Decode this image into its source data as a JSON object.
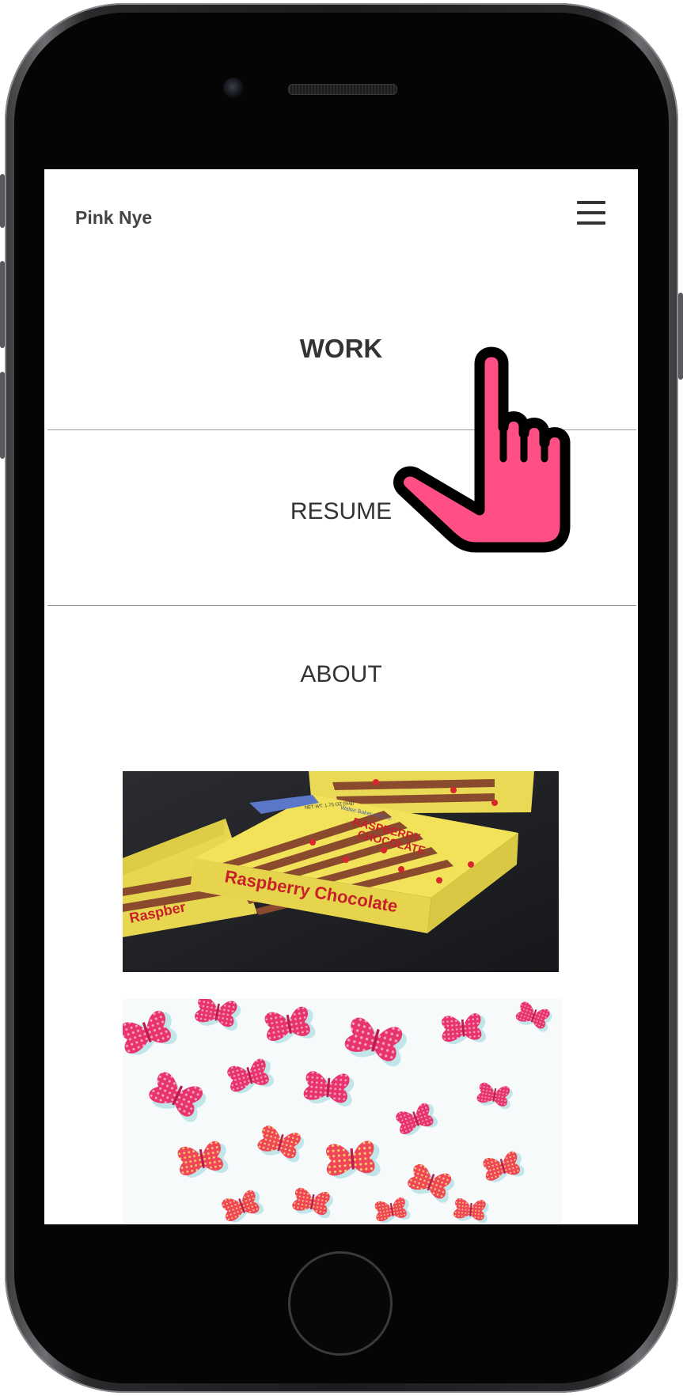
{
  "app": {
    "site_name": "Pink Nye"
  },
  "nav": {
    "items": [
      {
        "label": "WORK",
        "active": true
      },
      {
        "label": "RESUME",
        "active": false
      },
      {
        "label": "ABOUT",
        "active": false
      }
    ]
  },
  "icons": {
    "menu": "hamburger-menu-icon",
    "pointer": "pointing-hand-icon"
  },
  "thumbnails": {
    "chocolate": {
      "box_brand": "Walter Baker and Co.",
      "box_title_1": "RASPBERRY",
      "box_title_2": "CHOCOLATE",
      "side_label": "Raspberry Chocolate",
      "side_label_back": "Raspber",
      "weight": "NET WT. 1.75 OZ (50g)"
    }
  },
  "colors": {
    "hand_pink": "#ff4f85",
    "text_dark": "#333333",
    "divider": "#9a9a9a",
    "box_yellow": "#f2e25a",
    "butterfly_pink": "#e8336d"
  }
}
